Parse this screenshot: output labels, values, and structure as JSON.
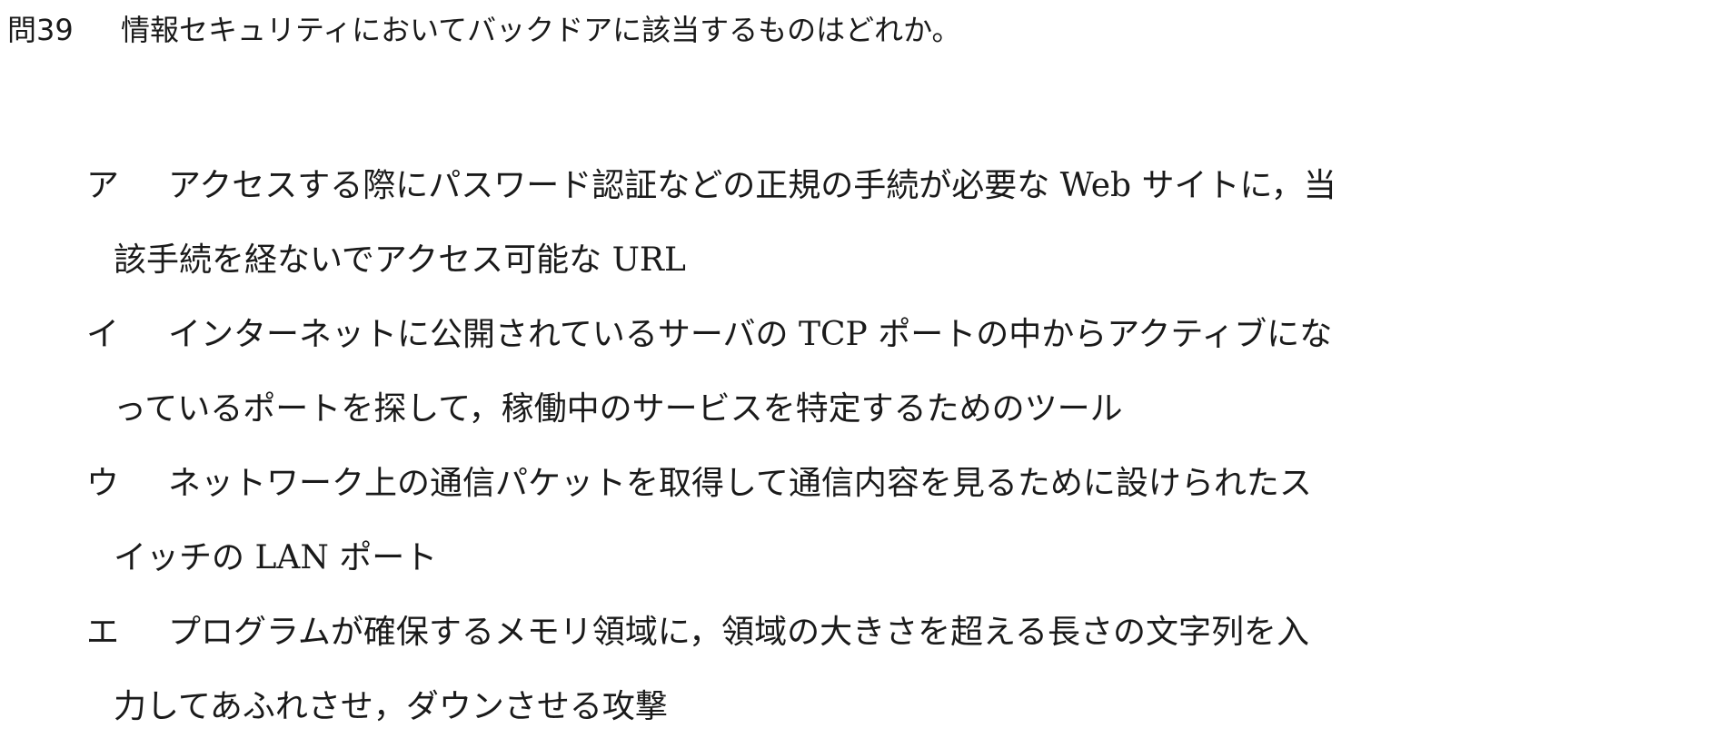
{
  "question": {
    "number": "問39",
    "text": "情報セキュリティにおいてバックドアに該当するものはどれか。"
  },
  "options": [
    {
      "marker": "ア",
      "lines": [
        "アクセスする際にパスワード認証などの正規の手続が必要な Web サイトに，当",
        "該手続を経ないでアクセス可能な URL"
      ]
    },
    {
      "marker": "イ",
      "lines": [
        "インターネットに公開されているサーバの TCP ポートの中からアクティブにな",
        "っているポートを探して，稼働中のサービスを特定するためのツール"
      ]
    },
    {
      "marker": "ウ",
      "lines": [
        "ネットワーク上の通信パケットを取得して通信内容を見るために設けられたス",
        "イッチの LAN ポート"
      ]
    },
    {
      "marker": "エ",
      "lines": [
        "プログラムが確保するメモリ領域に，領域の大きさを超える長さの文字列を入",
        "力してあふれさせ，ダウンさせる攻撃"
      ]
    }
  ]
}
